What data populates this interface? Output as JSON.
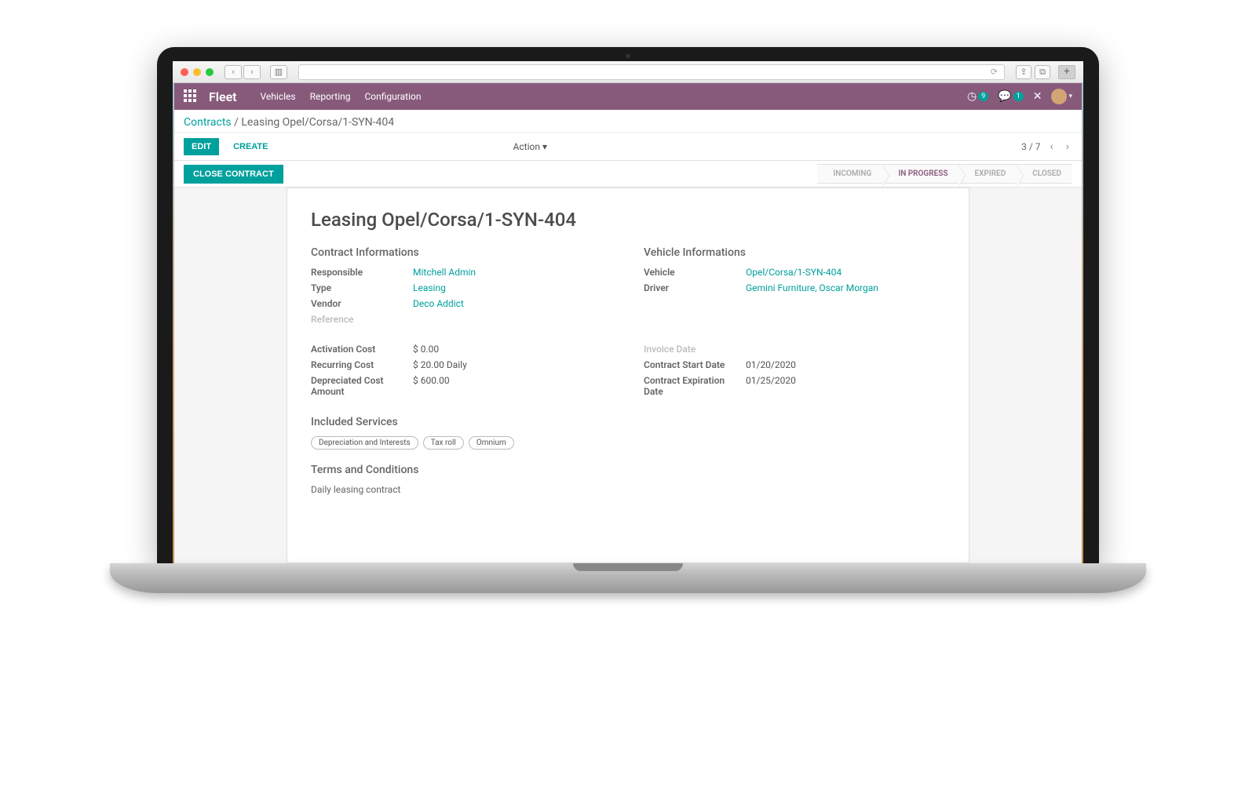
{
  "browser": {
    "url_refresh_icon": "⟳"
  },
  "topnav": {
    "app_name": "Fleet",
    "menu": [
      "Vehicles",
      "Reporting",
      "Configuration"
    ],
    "activity_count": "9",
    "message_count": "1"
  },
  "breadcrumb": {
    "parent": "Contracts",
    "separator": "/",
    "current": "Leasing Opel/Corsa/1-SYN-404"
  },
  "controls": {
    "edit": "EDIT",
    "create": "CREATE",
    "action": "Action",
    "pager": "3 / 7"
  },
  "statusbar": {
    "close_contract": "CLOSE CONTRACT",
    "stages": [
      "INCOMING",
      "IN PROGRESS",
      "EXPIRED",
      "CLOSED"
    ],
    "active_index": 1
  },
  "form": {
    "title": "Leasing Opel/Corsa/1-SYN-404",
    "sections": {
      "contract_info_title": "Contract Informations",
      "vehicle_info_title": "Vehicle Informations",
      "included_services_title": "Included Services",
      "terms_title": "Terms and Conditions"
    },
    "contract": {
      "responsible_label": "Responsible",
      "responsible_value": "Mitchell Admin",
      "type_label": "Type",
      "type_value": "Leasing",
      "vendor_label": "Vendor",
      "vendor_value": "Deco Addict",
      "reference_label": "Reference"
    },
    "vehicle": {
      "vehicle_label": "Vehicle",
      "vehicle_value": "Opel/Corsa/1-SYN-404",
      "driver_label": "Driver",
      "driver_value": "Gemini Furniture, Oscar Morgan"
    },
    "costs": {
      "activation_label": "Activation Cost",
      "activation_value": "$ 0.00",
      "recurring_label": "Recurring Cost",
      "recurring_value": "$ 20.00  Daily",
      "depreciated_label": "Depreciated Cost Amount",
      "depreciated_value": "$ 600.00"
    },
    "dates": {
      "invoice_label": "Invoice Date",
      "start_label": "Contract Start Date",
      "start_value": "01/20/2020",
      "expiration_label": "Contract Expiration Date",
      "expiration_value": "01/25/2020"
    },
    "services": [
      "Depreciation and Interests",
      "Tax roll",
      "Omnium"
    ],
    "terms_text": "Daily leasing contract"
  }
}
